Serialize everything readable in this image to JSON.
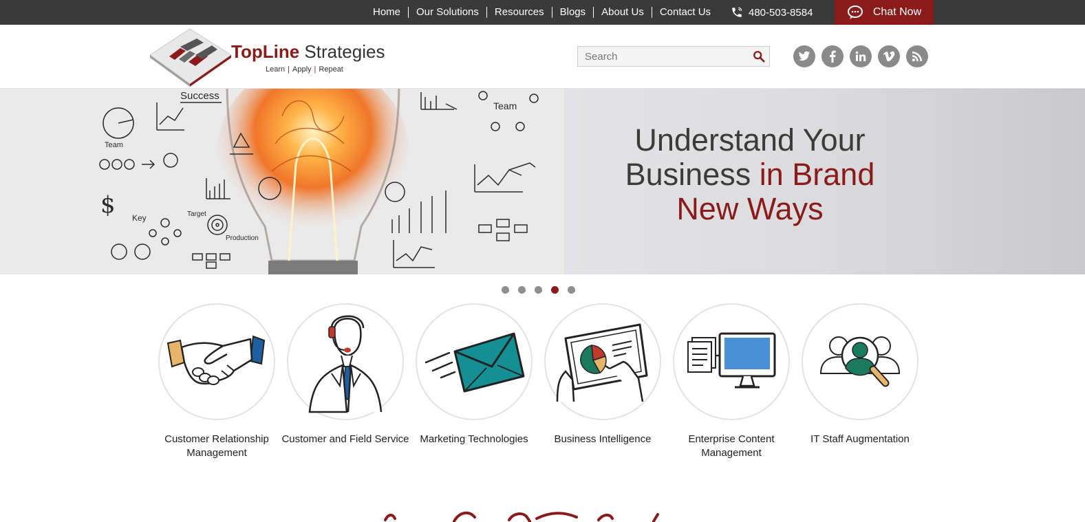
{
  "topbar": {
    "nav": [
      "Home",
      "Our Solutions",
      "Resources",
      "Blogs",
      "About Us",
      "Contact Us"
    ],
    "phone": "480-503-8584",
    "chat_label": "Chat Now"
  },
  "header": {
    "logo_bold": "TopLine",
    "logo_light": " Strategies",
    "tagline": [
      "Learn",
      "Apply",
      "Repeat"
    ],
    "search_placeholder": "Search",
    "social_icons": [
      "twitter-icon",
      "facebook-icon",
      "linkedin-icon",
      "vimeo-icon",
      "rss-icon"
    ]
  },
  "hero": {
    "line1": "Understand Your",
    "line2_dark": "Business ",
    "line2_red": "in Brand",
    "line3": "New Ways",
    "slide_count": 5,
    "active_slide": 4
  },
  "services": [
    {
      "label": "Customer Relationship Management",
      "icon": "handshake-icon"
    },
    {
      "label": "Customer and Field Service",
      "icon": "support-agent-icon"
    },
    {
      "label": "Marketing Technologies",
      "icon": "envelope-icon"
    },
    {
      "label": "Business Intelligence",
      "icon": "tablet-chart-icon"
    },
    {
      "label": "Enterprise Content Management",
      "icon": "documents-monitor-icon"
    },
    {
      "label": "IT Staff Augmentation",
      "icon": "people-search-icon"
    }
  ],
  "colors": {
    "brand_red": "#8b1a1a",
    "topbar_bg": "#3a3a3a",
    "social_gray": "#8a8a8a"
  }
}
